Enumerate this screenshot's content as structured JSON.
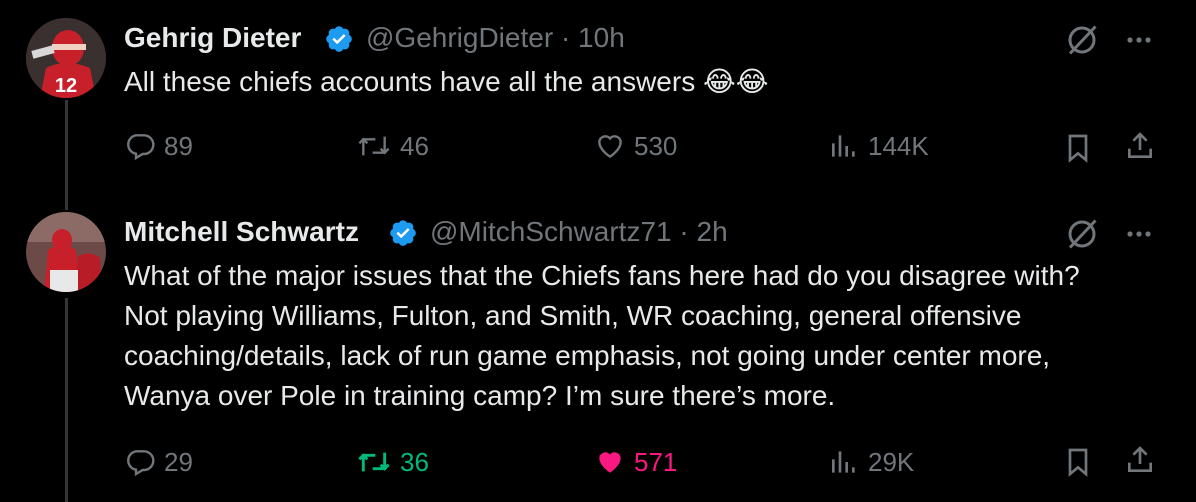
{
  "tweets": [
    {
      "name": "Gehrig Dieter",
      "handle": "@GehrigDieter",
      "time": "10h",
      "dot": "·",
      "text": "All these chiefs accounts have all the answers 😂😂",
      "actions": {
        "replies": "89",
        "reposts": "46",
        "likes": "530",
        "views": "144K"
      },
      "avatar_jersey": "12"
    },
    {
      "name": "Mitchell Schwartz",
      "handle": "@MitchSchwartz71",
      "time": "2h",
      "dot": "·",
      "text": "What of the major issues that the Chiefs fans here had do you disagree with? Not playing Williams, Fulton, and Smith, WR coaching, general offensive coaching/details, lack of run game emphasis, not going under center more, Wanya over Pole in training camp? I’m sure there’s more.",
      "actions": {
        "replies": "29",
        "reposts": "36",
        "likes": "571",
        "views": "29K"
      },
      "reposted": true,
      "liked": true
    }
  ],
  "colors": {
    "background": "#000000",
    "text": "#e7e9ea",
    "muted": "#71767b",
    "verified": "#1d9bf0",
    "repost_active": "#00ba7c",
    "like_active": "#f91880"
  },
  "icons": [
    "reply-icon",
    "repost-icon",
    "like-icon",
    "views-icon",
    "bookmark-icon",
    "share-icon",
    "grok-icon",
    "more-icon",
    "verified-icon"
  ]
}
